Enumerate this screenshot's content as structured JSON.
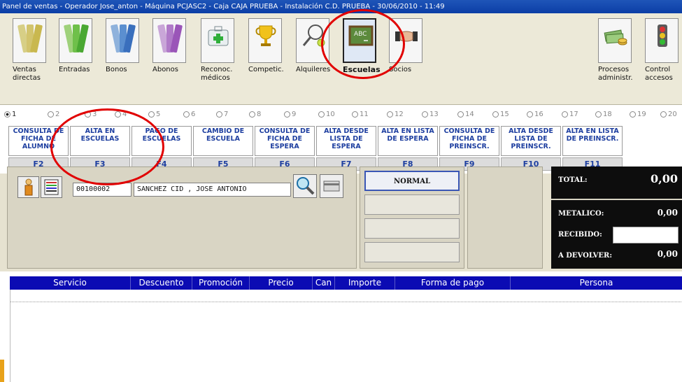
{
  "window": {
    "title": "Panel de ventas - Operador Jose_anton - Máquina PCJASC2 - Caja CAJA PRUEBA - Instalación C.D. PRUEBA - 30/06/2010 - 11:49"
  },
  "toolbar": {
    "items": [
      {
        "label": "Ventas directas",
        "icon": "ticket-icon"
      },
      {
        "label": "Entradas",
        "icon": "ticket-icon"
      },
      {
        "label": "Bonos",
        "icon": "ticket-icon"
      },
      {
        "label": "Abonos",
        "icon": "ticket-icon"
      },
      {
        "label": "Reconoc. médicos",
        "icon": "medical-kit-icon"
      },
      {
        "label": "Competic.",
        "icon": "trophy-icon"
      },
      {
        "label": "Alquileres",
        "icon": "tennis-racket-icon"
      },
      {
        "label": "Escuelas",
        "icon": "chalkboard-icon"
      },
      {
        "label": "Socios",
        "icon": "handshake-icon"
      },
      {
        "label": "Procesos administr.",
        "icon": "money-icon"
      },
      {
        "label": "Control accesos",
        "icon": "traffic-light-icon"
      }
    ]
  },
  "options": {
    "selected": "1",
    "items": [
      "1",
      "2",
      "3",
      "4",
      "5",
      "6",
      "7",
      "8",
      "9",
      "10",
      "11",
      "12",
      "13",
      "14",
      "15",
      "16",
      "17",
      "18",
      "19",
      "20"
    ]
  },
  "actions": [
    {
      "label": "CONSULTA DE FICHA DE ALUMNO",
      "key": "F2"
    },
    {
      "label": "ALTA EN ESCUELAS",
      "key": "F3"
    },
    {
      "label": "PAGO DE ESCUELAS",
      "key": "F4"
    },
    {
      "label": "CAMBIO DE ESCUELA",
      "key": "F5"
    },
    {
      "label": "CONSULTA DE FICHA DE ESPERA",
      "key": "F6"
    },
    {
      "label": "ALTA DESDE LISTA DE ESPERA",
      "key": "F7"
    },
    {
      "label": "ALTA EN LISTA DE ESPERA",
      "key": "F8"
    },
    {
      "label": "CONSULTA DE FICHA DE PREINSCR.",
      "key": "F9"
    },
    {
      "label": "ALTA DESDE LISTA DE PREINSCR.",
      "key": "F10"
    },
    {
      "label": "ALTA EN LISTA DE PREINSCR.",
      "key": "F11"
    }
  ],
  "client": {
    "code": "00100002",
    "name": "SANCHEZ CID , JOSE ANTONIO"
  },
  "payment_mode": {
    "normal_label": "NORMAL"
  },
  "totals": {
    "total_label": "TOTAL:",
    "total_value": "0,00",
    "cash_label": "METALICO:",
    "cash_value": "0,00",
    "received_label": "RECIBIDO:",
    "change_label": "A DEVOLVER:",
    "change_value": "0,00"
  },
  "table": {
    "columns": [
      "Servicio",
      "Descuento",
      "Promoción",
      "Precio",
      "Can",
      "Importe",
      "Forma de pago",
      "Persona"
    ]
  },
  "colors": {
    "titlebar": "#0b3ea6",
    "header_blue": "#0b0bb3",
    "action_text": "#1e3fa0",
    "annotation_red": "#e10000"
  }
}
